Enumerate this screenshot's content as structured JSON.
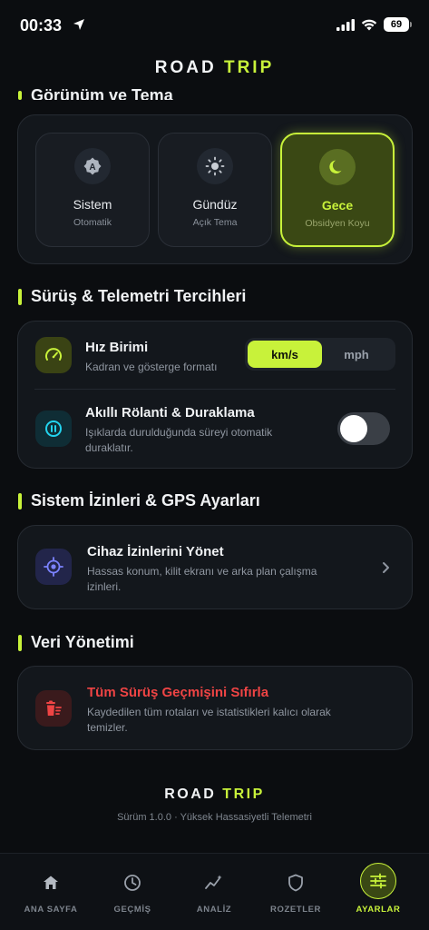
{
  "status": {
    "time": "00:33",
    "battery": "69"
  },
  "app": {
    "title_a": "ROAD",
    "title_b": "TRIP"
  },
  "appearance": {
    "title": "Görünüm ve Tema",
    "options": [
      {
        "name": "Sistem",
        "sub": "Otomatik",
        "icon": "auto-theme-icon"
      },
      {
        "name": "Gündüz",
        "sub": "Açık Tema",
        "icon": "sun-icon"
      },
      {
        "name": "Gece",
        "sub": "Obsidyen Koyu",
        "icon": "moon-icon",
        "selected": true
      }
    ]
  },
  "driving": {
    "title": "Sürüş & Telemetri Tercihleri",
    "speed_unit": {
      "title": "Hız Birimi",
      "desc": "Kadran ve gösterge formatı",
      "options": [
        "km/s",
        "mph"
      ],
      "selected": "km/s"
    },
    "auto_pause": {
      "title": "Akıllı Rölanti & Duraklama",
      "desc_1": "Işıklarda durulduğunda süreyi otomatik",
      "desc_2": "duraklatır.",
      "enabled": false
    }
  },
  "permissions": {
    "title": "Sistem İzinleri & GPS Ayarları",
    "manage": {
      "title": "Cihaz İzinlerini Yönet",
      "desc_1": "Hassas konum, kilit ekranı ve arka plan çalışma",
      "desc_2": "izinleri."
    }
  },
  "data_mgmt": {
    "title": "Veri Yönetimi",
    "reset": {
      "title": "Tüm Sürüş Geçmişini Sıfırla",
      "desc_1": "Kaydedilen tüm rotaları ve istatistikleri kalıcı olarak",
      "desc_2": "temizler."
    }
  },
  "footer": {
    "brand_a": "ROAD",
    "brand_b": "TRIP",
    "version": "Sürüm 1.0.0 · Yüksek Hassasiyetli Telemetri"
  },
  "tabs": [
    {
      "label": "ANA SAYFA",
      "icon": "home-icon"
    },
    {
      "label": "GEÇMİŞ",
      "icon": "clock-icon"
    },
    {
      "label": "ANALİZ",
      "icon": "analytics-icon"
    },
    {
      "label": "ROZETLER",
      "icon": "shield-icon"
    },
    {
      "label": "AYARLAR",
      "icon": "sliders-icon",
      "active": true
    }
  ],
  "colors": {
    "accent": "#c8f23a",
    "background": "#0b0d10",
    "card": "#13171c",
    "danger": "#ef4444",
    "cyan": "#22d3ee",
    "purple": "#7c83ff"
  }
}
